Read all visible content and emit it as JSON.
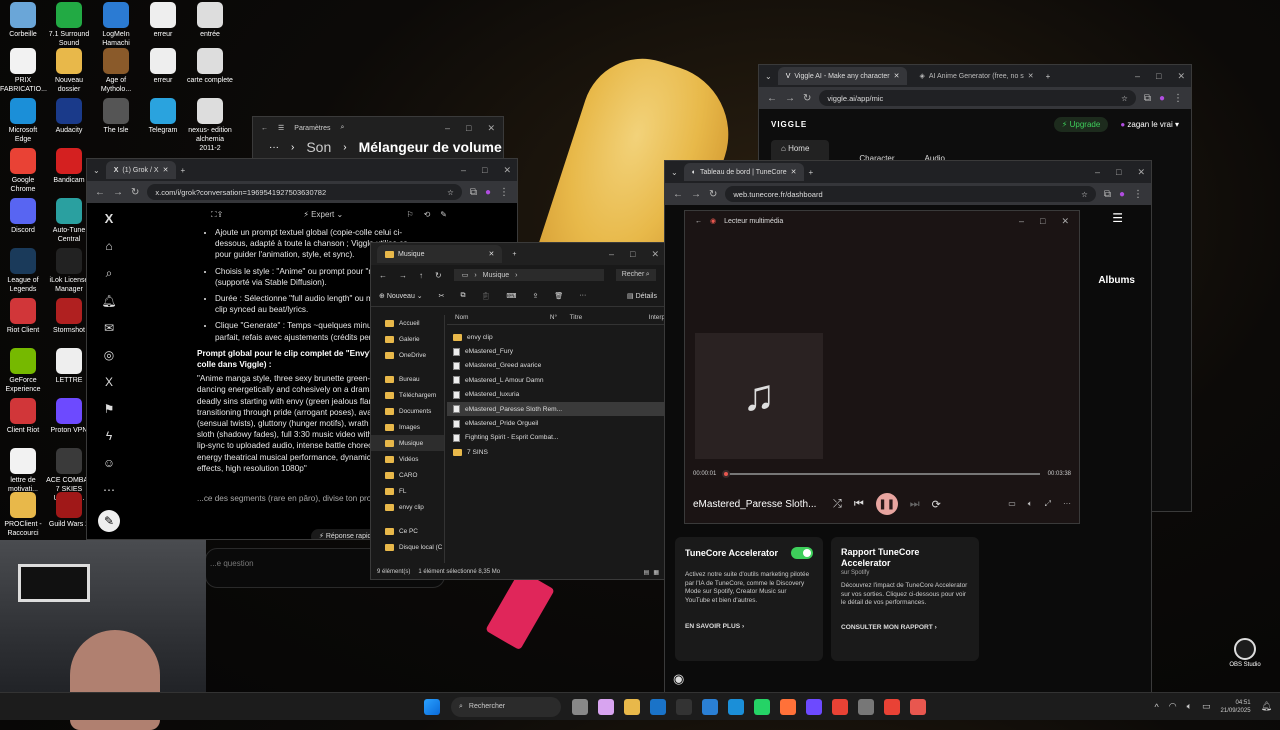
{
  "desktop": {
    "icons": [
      {
        "label": "Corbeille",
        "icon": "recycle-bin-icon",
        "color": "#6aa6d8"
      },
      {
        "label": "7.1 Surround Sound",
        "icon": "speaker-icon",
        "color": "#22aa44"
      },
      {
        "label": "LogMeIn Hamachi",
        "icon": "hamachi-icon",
        "color": "#2b7bd3"
      },
      {
        "label": "erreur",
        "icon": "error-file-icon",
        "color": "#eeeeee"
      },
      {
        "label": "entrée",
        "icon": "file-icon",
        "color": "#dddddd"
      },
      {
        "label": "PRIX FABRICATIO...",
        "icon": "document-icon",
        "color": "#f2f2f2"
      },
      {
        "label": "Nouveau dossier",
        "icon": "folder-icon",
        "color": "#e8b84a"
      },
      {
        "label": "Age of Mytholo...",
        "icon": "game-icon",
        "color": "#8a5a2a"
      },
      {
        "label": "erreur",
        "icon": "error-file-icon",
        "color": "#eeeeee"
      },
      {
        "label": "carte complete",
        "icon": "image-file-icon",
        "color": "#dddddd"
      },
      {
        "label": "Microsoft Edge",
        "icon": "edge-icon",
        "color": "#1b8fd8"
      },
      {
        "label": "Audacity",
        "icon": "audacity-icon",
        "color": "#1a3a8a"
      },
      {
        "label": "The Isle",
        "icon": "game-icon",
        "color": "#555555"
      },
      {
        "label": "Telegram",
        "icon": "telegram-icon",
        "color": "#2aa3de"
      },
      {
        "label": "nexus- edition alchemia 2011-2",
        "icon": "file-icon",
        "color": "#dddddd"
      },
      {
        "label": "Google Chrome",
        "icon": "chrome-icon",
        "color": "#e94235"
      },
      {
        "label": "Bandicam",
        "icon": "bandicam-icon",
        "color": "#d42020"
      },
      {
        "label": "Discord",
        "icon": "discord-icon",
        "color": "#5865f2"
      },
      {
        "label": "Auto-Tune Central",
        "icon": "autotune-icon",
        "color": "#2aa0a0"
      },
      {
        "label": "League of Legends",
        "icon": "lol-icon",
        "color": "#1a3a5a"
      },
      {
        "label": "iLok License Manager",
        "icon": "ilok-icon",
        "color": "#222222"
      },
      {
        "label": "Riot Client",
        "icon": "riot-icon",
        "color": "#d13639"
      },
      {
        "label": "Stormshot",
        "icon": "game-icon",
        "color": "#b02020"
      },
      {
        "label": "GeForce Experience",
        "icon": "nvidia-icon",
        "color": "#76b900"
      },
      {
        "label": "LETTRE",
        "icon": "document-icon",
        "color": "#eeeeee"
      },
      {
        "label": "Client Riot",
        "icon": "riot-icon",
        "color": "#d13639"
      },
      {
        "label": "Proton VPN",
        "icon": "vpn-icon",
        "color": "#6d4aff"
      },
      {
        "label": "lettre de motivati...",
        "icon": "document-icon",
        "color": "#f2f2f2"
      },
      {
        "label": "ACE COMBAT 7 SKIES UNKNO...",
        "icon": "game-icon",
        "color": "#3a3a3a"
      },
      {
        "label": "PROClient - Raccourci",
        "icon": "folder-icon",
        "color": "#e8b84a"
      },
      {
        "label": "Guild Wars 2",
        "icon": "game-icon",
        "color": "#a01818"
      }
    ]
  },
  "settings": {
    "title": "Paramètres",
    "crumb": "Son",
    "heading": "Mélangeur de volume"
  },
  "grok": {
    "tab": "(1) Grok / X",
    "url": "x.com/i/grok?conversation=1969541927503630782",
    "mode": "Expert",
    "bullets": [
      "Ajoute un prompt textuel global (copie-colle celui ci-dessous, adapté à toute la chanson ; Viggle utilise ça pour guider l'animation, style, et sync).",
      "Choisis le style : \"Anime\" ou prompt pour \"manga\" (supporté via Stable Diffusion).",
      "Durée : Sélectionne \"full audio length\" ou max 10 en un clip synced au beat/lyrics.",
      "Clique \"Generate\" : Temps ~quelques minutes, s pas parfait, refais avec ajustements (crédits pen essais)."
    ],
    "prompt_heading": "Prompt global pour le clip complet de \"Envy's Fire / Fe colle dans Viggle) :",
    "prompt_text": "\"Anime manga style, three sexy brunette green-eyed girls dancing energetically and cohesively on a dramatic stag deadly sins starting with envy (green jealous flames, plot transitioning through pride (arrogant poses), avarice (gol (sensual twists), gluttony (hunger motifs), wrath (red aura sloth (shadowy fades), full 3:30 music video with bilingua lip-sync to uploaded audio, intense battle choreography energy theatrical musical performance, dynamic camera effects, high resolution 1080p\"",
    "footer_text": "...ce des segments (rare en pâro), divise ton pro",
    "quick_reply": "Réponse rapide",
    "ask_placeholder": "...e question"
  },
  "explorer": {
    "title": "Musique",
    "breadcrumb": "Musique",
    "search": "Recher",
    "new_label": "Nouveau",
    "details_label": "Détails",
    "columns": [
      "Nom",
      "N°",
      "Titre",
      "Interp"
    ],
    "sidebar": [
      "Accueil",
      "Galerie",
      "OneDrive",
      "Bureau",
      "Téléchargem",
      "Documents",
      "Images",
      "Musique",
      "Vidéos",
      "CARO",
      "FL",
      "envy clip",
      "Ce PC",
      "Disque local (C"
    ],
    "files": [
      {
        "name": "envy clip",
        "type": "folder"
      },
      {
        "name": "eMastered_Fury",
        "type": "file"
      },
      {
        "name": "eMastered_Greed  avarice",
        "type": "file"
      },
      {
        "name": "eMastered_L Amour Damn",
        "type": "file"
      },
      {
        "name": "eMastered_luxuria",
        "type": "file"
      },
      {
        "name": "eMastered_Paresse  Sloth Rem...",
        "type": "file"
      },
      {
        "name": "eMastered_Pride  Orgueil",
        "type": "file"
      },
      {
        "name": "Fighting Spirit - Esprit Combat...",
        "type": "file"
      },
      {
        "name": "7 SINS",
        "type": "folder"
      }
    ],
    "status": "9 élément(s)",
    "selection": "1 élément sélectionné  8,35 Mo"
  },
  "viggle": {
    "tabs": [
      "Viggle AI - Make any character",
      "AI Anime Generator (free, no s"
    ],
    "url": "viggle.ai/app/mic",
    "brand": "VIGGLE",
    "upgrade": "Upgrade",
    "user": "zagan le vrai",
    "nav_home": "Home",
    "tab_character": "Character",
    "tab_audio": "Audio"
  },
  "tunecore": {
    "tab": "Tableau de bord | TuneCore",
    "url": "web.tunecore.fr/dashboard",
    "albums": "Albums",
    "card1_title": "TuneCore Accelerator",
    "card1_text": "Activez notre suite d'outils marketing pilotée par l'IA de TuneCore, comme le Discovery Mode sur Spotify, Creator Music sur YouTube et bien d'autres.",
    "card1_link": "EN SAVOIR PLUS ›",
    "card2_title": "Rapport TuneCore Accelerator",
    "card2_sub": "sur Spotify",
    "card2_text": "Découvrez l'impact de TuneCore Accelerator sur vos sorties. Cliquez ci-dessous pour voir le détail de vos performances.",
    "card2_link": "CONSULTER MON RAPPORT ›"
  },
  "player": {
    "title": "Lecteur multimédia",
    "time_current": "00:00:01",
    "time_total": "00:03:38",
    "track": "eMastered_Paresse   Sloth...",
    "progress": 0.005
  },
  "obs": {
    "label": "OBS Studio"
  },
  "taskbar": {
    "search": "Rechercher",
    "time": "04:51",
    "date": "21/09/2025"
  },
  "colors": {
    "accent_green": "#3ecf5b",
    "viggle_purple": "#b14de0",
    "folder": "#e8b84a"
  }
}
